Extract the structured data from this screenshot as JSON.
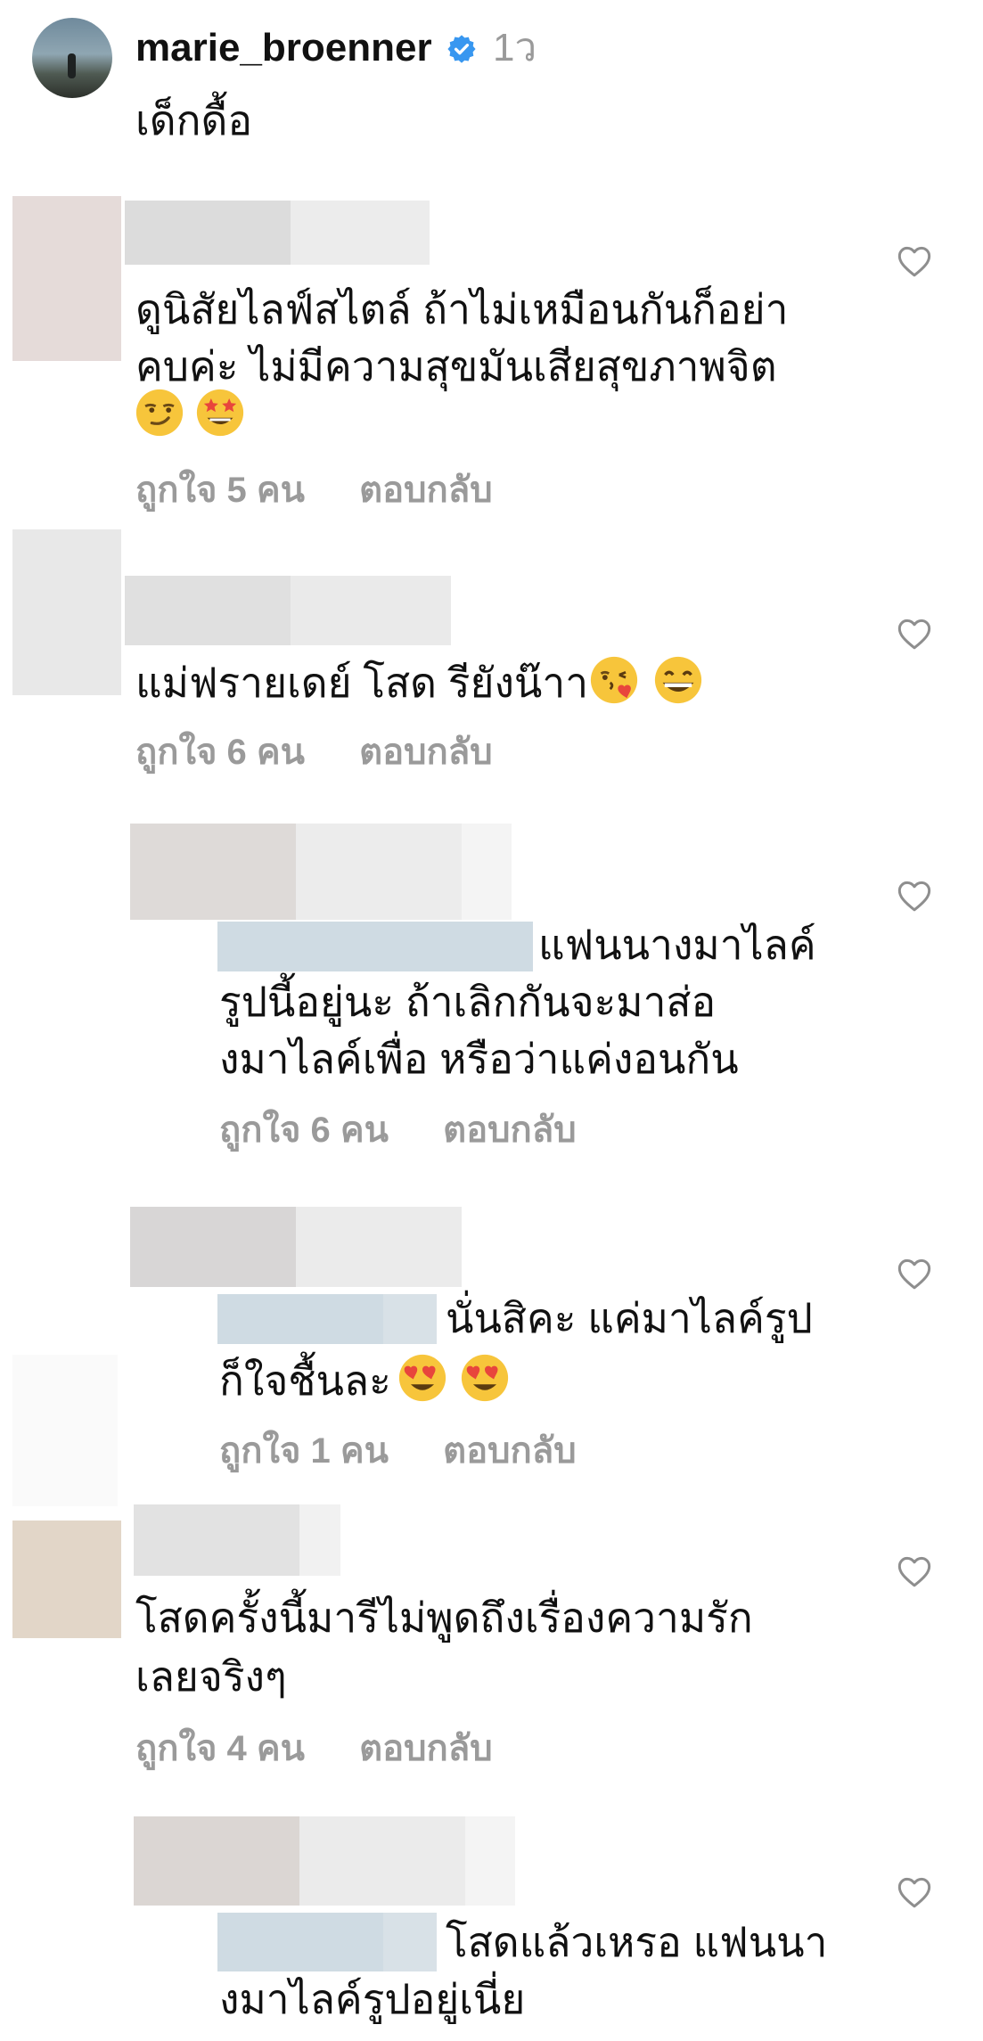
{
  "post": {
    "username": "marie_broenner",
    "verified": true,
    "time": "1ว",
    "caption": "เด็กดื้อ",
    "accent_color": "#3897f0"
  },
  "comments": [
    {
      "text_lines": [
        "ดูนิสัยไลฟ์สไตล์ ถ้าไม่เหมือนกันก็อย่า",
        "คบค่ะ ไม่มีความสุขมันเสียสุขภาพจิต"
      ],
      "emojis": [
        "smirk-face",
        "star-struck-face"
      ],
      "likes": "ถูกใจ 5 คน",
      "reply": "ตอบกลับ"
    },
    {
      "text_lines": [
        "แม่ฟรายเดย์ โสด รียังน๊าา"
      ],
      "emojis": [
        "kissing-heart-face",
        "grinning-face"
      ],
      "likes": "ถูกใจ 6 คน",
      "reply": "ตอบกลับ"
    },
    {
      "text_lines": [
        "แฟนนางมาไลค์",
        "รูปนี้อยู่นะ ถ้าเลิกกันจะมาส่อ",
        "งมาไลค์เพื่อ หรือว่าแค่งอนกัน"
      ],
      "likes": "ถูกใจ 6 คน",
      "reply": "ตอบกลับ"
    },
    {
      "text_lines": [
        "นั่นสิคะ แค่มาไลค์รูป",
        "ก็ใจชื้นละ"
      ],
      "emojis": [
        "heart-eyes-face",
        "heart-eyes-face"
      ],
      "likes": "ถูกใจ 1 คน",
      "reply": "ตอบกลับ"
    },
    {
      "text_lines": [
        "โสดครั้งนี้มารีไม่พูดถึงเรื่องความรัก",
        "เลยจริงๆ"
      ],
      "likes": "ถูกใจ 4 คน",
      "reply": "ตอบกลับ"
    },
    {
      "text_lines": [
        "โสดแล้วเหรอ แฟนนา",
        "งมาไลค์รูปอยู่เนี่ย"
      ]
    }
  ]
}
